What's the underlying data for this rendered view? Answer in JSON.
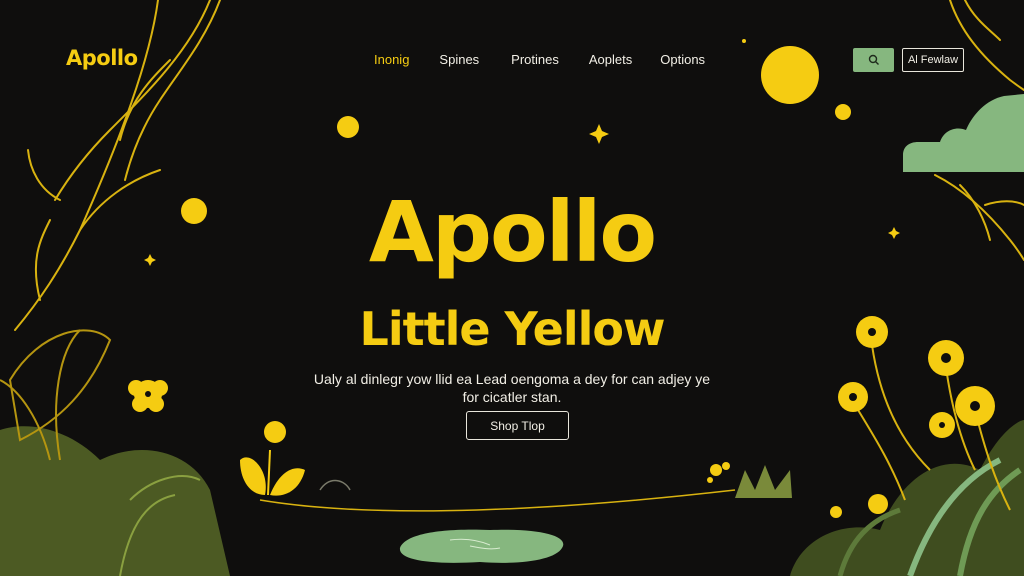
{
  "brand": {
    "logo_text": "Apollo"
  },
  "nav": {
    "items": [
      {
        "label": "Inonig",
        "active": true
      },
      {
        "label": "Spines",
        "active": false
      },
      {
        "label": "Protines",
        "active": false
      },
      {
        "label": "Aoplets",
        "active": false
      },
      {
        "label": "Options",
        "active": false
      }
    ]
  },
  "header_actions": {
    "search_icon": "search-icon",
    "cta_label": "Al Fewlaw"
  },
  "hero": {
    "title": "Apollo",
    "subtitle": "Little Yellow",
    "description": "Ualy al dinlegr yow llid ea Lead oengoma a dey for can adjey ye for cicatler stan.",
    "button_label": "Shop Tlop"
  },
  "colors": {
    "background": "#0f0e0d",
    "accent_yellow": "#f5cc12",
    "accent_green": "#86b77f",
    "text_light": "#f2efe6"
  }
}
